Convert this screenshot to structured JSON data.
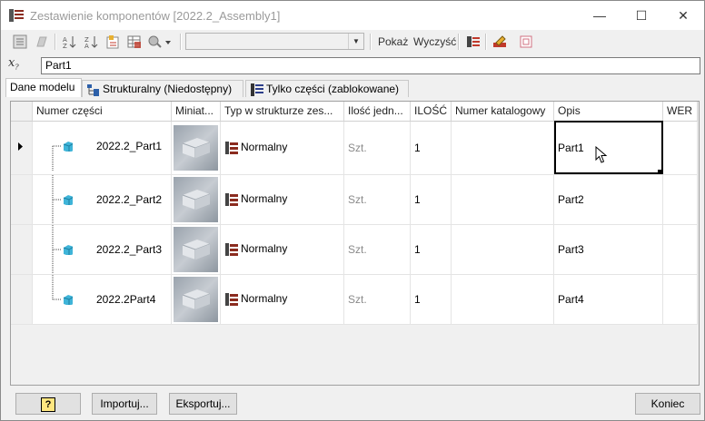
{
  "window": {
    "title": "Zestawienie komponentów [2022.2_Assembly1]",
    "minimize": "—",
    "maximize": "☐",
    "close": "✕"
  },
  "toolbar": {
    "combo_value": "",
    "show_label": "Pokaż",
    "clear_label": "Wyczyść"
  },
  "formula": {
    "fx_label": "x",
    "value": "Part1"
  },
  "tabs": [
    {
      "label": "Dane modelu",
      "active": true
    },
    {
      "label": "Strukturalny (Niedostępny)",
      "active": false
    },
    {
      "label": "Tylko części (zablokowane)",
      "active": false
    }
  ],
  "grid": {
    "columns": [
      "Numer części",
      "Miniat...",
      "Typ w strukturze zes...",
      "Ilość jedn...",
      "ILOŚĆ",
      "Numer katalogowy",
      "Opis",
      "WER"
    ],
    "rows": [
      {
        "part_number": "2022.2_Part1",
        "structure": "Normalny",
        "unit_qty": "Szt.",
        "qty": "1",
        "catalog": "",
        "description": "Part1",
        "rev": "",
        "current": true
      },
      {
        "part_number": "2022.2_Part2",
        "structure": "Normalny",
        "unit_qty": "Szt.",
        "qty": "1",
        "catalog": "",
        "description": "Part2",
        "rev": "",
        "current": false
      },
      {
        "part_number": "2022.2_Part3",
        "structure": "Normalny",
        "unit_qty": "Szt.",
        "qty": "1",
        "catalog": "",
        "description": "Part3",
        "rev": "",
        "current": false
      },
      {
        "part_number": "2022.2Part4",
        "structure": "Normalny",
        "unit_qty": "Szt.",
        "qty": "1",
        "catalog": "",
        "description": "Part4",
        "rev": "",
        "current": false
      }
    ]
  },
  "footer": {
    "help_label": "?",
    "import_label": "Importuj...",
    "export_label": "Eksportuj...",
    "close_label": "Koniec"
  },
  "colors": {
    "part_cube": "#3fb4d8",
    "thumb_gray": "#a7afb8",
    "accent_red": "#c0392b"
  }
}
